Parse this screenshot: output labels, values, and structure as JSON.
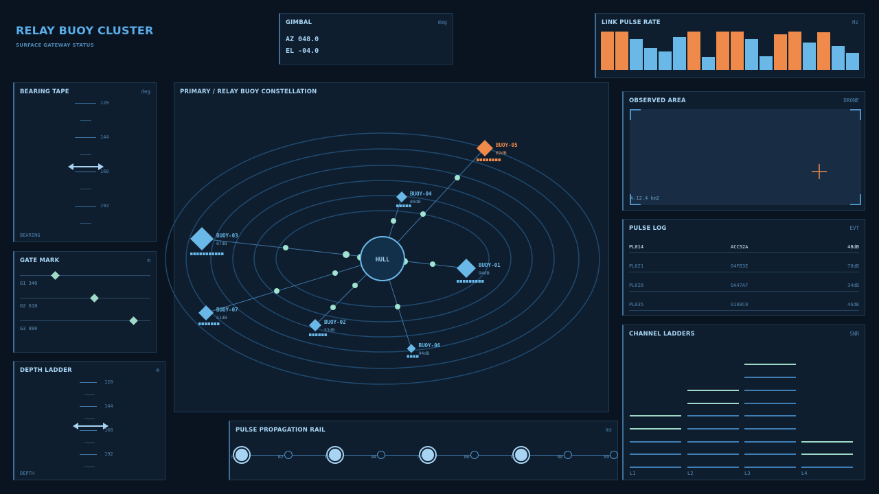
{
  "header": {
    "title": "RELAY BUOY CLUSTER",
    "subtitle": "SURFACE GATEWAY STATUS"
  },
  "gimbal": {
    "title": "GIMBAL",
    "unit": "deg",
    "az": "AZ 048.0",
    "el": "EL -04.0"
  },
  "link_pulse": {
    "title": "LINK PULSE RATE",
    "unit": "Hz",
    "bars": [
      {
        "value": 1.0,
        "color": "#f08a4b"
      },
      {
        "value": 1.0,
        "color": "#f08a4b"
      },
      {
        "value": 0.8,
        "color": "#6ab8e8"
      },
      {
        "value": 0.57,
        "color": "#6ab8e8"
      },
      {
        "value": 0.48,
        "color": "#6ab8e8"
      },
      {
        "value": 0.86,
        "color": "#6ab8e8"
      },
      {
        "value": 1.0,
        "color": "#f08a4b"
      },
      {
        "value": 0.34,
        "color": "#6ab8e8"
      },
      {
        "value": 1.0,
        "color": "#f08a4b"
      },
      {
        "value": 1.0,
        "color": "#f08a4b"
      },
      {
        "value": 0.8,
        "color": "#6ab8e8"
      },
      {
        "value": 0.36,
        "color": "#6ab8e8"
      },
      {
        "value": 0.93,
        "color": "#f08a4b"
      },
      {
        "value": 1.0,
        "color": "#f08a4b"
      },
      {
        "value": 0.72,
        "color": "#6ab8e8"
      },
      {
        "value": 0.98,
        "color": "#f08a4b"
      },
      {
        "value": 0.62,
        "color": "#6ab8e8"
      },
      {
        "value": 0.45,
        "color": "#6ab8e8"
      }
    ]
  },
  "bearing": {
    "title": "BEARING TAPE",
    "unit": "deg",
    "footer": "BEARING",
    "ticks": [
      "120",
      "144",
      "168",
      "192"
    ]
  },
  "gate": {
    "title": "GATE MARK",
    "unit": "m",
    "rows": [
      {
        "label": "G1 340",
        "position": 0.27
      },
      {
        "label": "G2 610",
        "position": 0.57
      },
      {
        "label": "G3 880",
        "position": 0.87
      }
    ]
  },
  "depth": {
    "title": "DEPTH LADDER",
    "unit": "m",
    "footer": "DEPTH",
    "ticks": [
      "120",
      "144",
      "168",
      "192"
    ]
  },
  "constellation": {
    "title": "PRIMARY / RELAY BUOY CONSTELLATION",
    "hub": "HULL",
    "buoys": [
      {
        "name": "BUOY-01",
        "db": "94dB",
        "hot": false
      },
      {
        "name": "BUOY-02",
        "db": "53dB",
        "hot": false
      },
      {
        "name": "BUOY-03",
        "db": "87dB",
        "hot": false
      },
      {
        "name": "BUOY-04",
        "db": "80dB",
        "hot": false
      },
      {
        "name": "BUOY-05",
        "db": "62dB",
        "hot": true
      },
      {
        "name": "BUOY-06",
        "db": "94dB",
        "hot": false
      },
      {
        "name": "BUOY-07",
        "db": "51dB",
        "hot": false
      }
    ]
  },
  "observed": {
    "title": "OBSERVED AREA",
    "source": "DRONE",
    "area": "A:12.4 km2"
  },
  "pulse_log": {
    "title": "PULSE LOG",
    "unit": "EVT",
    "rows": [
      {
        "id": "PL014",
        "code": "ACC52A",
        "value": "48dB",
        "active": true
      },
      {
        "id": "PL021",
        "code": "04FB3E",
        "value": "78dB",
        "active": false
      },
      {
        "id": "PL028",
        "code": "0A47AF",
        "value": "34dB",
        "active": false
      },
      {
        "id": "PL035",
        "code": "0108C0",
        "value": "46dB",
        "active": false
      }
    ]
  },
  "channel": {
    "title": "CHANNEL LADDERS",
    "unit": "SNR",
    "columns": [
      {
        "label": "L1",
        "rungs": 5,
        "hi": 2
      },
      {
        "label": "L2",
        "rungs": 7,
        "hi": 2
      },
      {
        "label": "L3",
        "rungs": 9,
        "hi": 1
      },
      {
        "label": "L4",
        "rungs": 3,
        "hi": 2
      }
    ]
  },
  "rail": {
    "title": "PULSE PROPAGATION RAIL",
    "unit": "ms",
    "nodes": [
      {
        "label": "N1",
        "major": true
      },
      {
        "label": "N2",
        "major": false
      },
      {
        "label": "N3",
        "major": true
      },
      {
        "label": "N4",
        "major": false
      },
      {
        "label": "N5",
        "major": true
      },
      {
        "label": "N6",
        "major": false
      },
      {
        "label": "N7",
        "major": true
      },
      {
        "label": "N8",
        "major": false
      },
      {
        "label": "N9",
        "major": false
      }
    ]
  }
}
